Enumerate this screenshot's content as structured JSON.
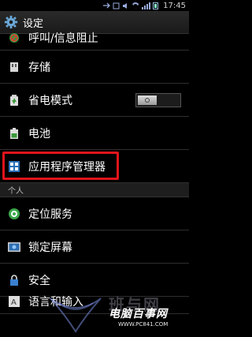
{
  "status": {
    "time": "17:45"
  },
  "header": {
    "title": "设定"
  },
  "items": {
    "call_block": "呼叫/信息阻止",
    "storage": "存储",
    "power_saving": "省电模式",
    "battery": "电池",
    "app_manager": "应用程序管理器",
    "location": "定位服务",
    "lock_screen": "锁定屏幕",
    "security": "安全",
    "language": "语言和输入"
  },
  "sections": {
    "personal": "个人"
  },
  "watermark": {
    "brand": "电脑百事网",
    "url": "WWW.PC841.COM",
    "faded": "班与网",
    "faded2": "我回"
  },
  "colors": {
    "highlight": "#e1141b",
    "background": "#000000"
  },
  "icons": [
    "settings-gear-icon",
    "call-block-icon",
    "storage-icon",
    "power-saving-icon",
    "battery-icon",
    "app-manager-icon",
    "location-icon",
    "lock-screen-icon",
    "security-icon",
    "language-icon"
  ]
}
